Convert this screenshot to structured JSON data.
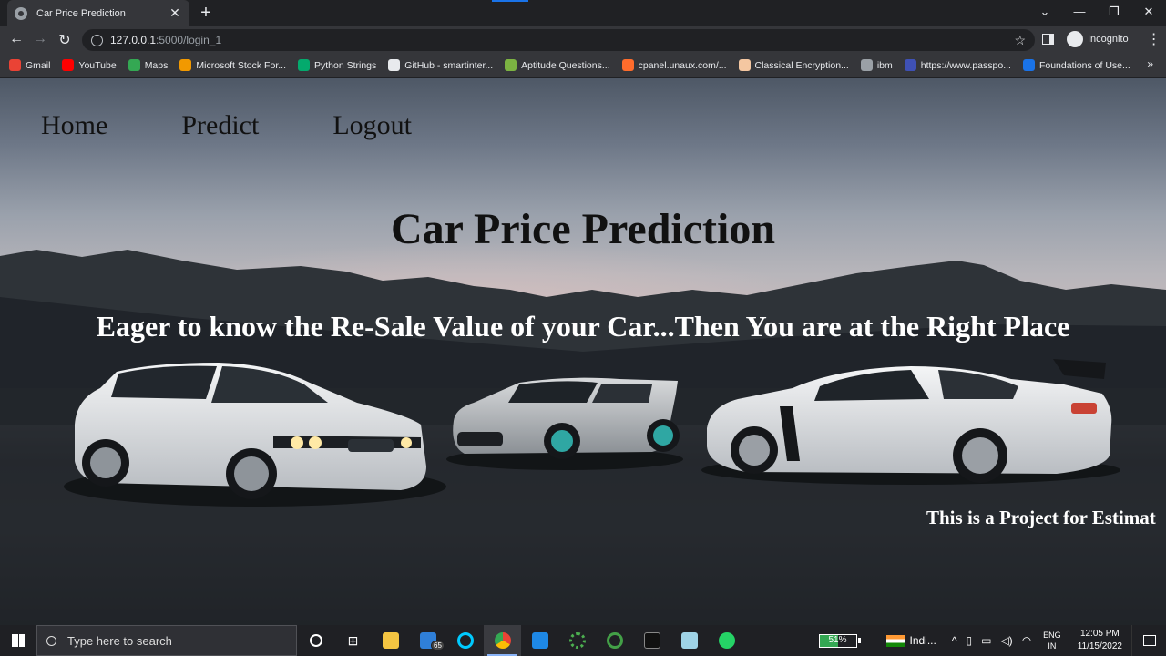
{
  "browser": {
    "tab_title": "Car Price Prediction",
    "tab_close": "✕",
    "new_tab": "+",
    "window_controls": [
      "⌄",
      "—",
      "❐",
      "✕"
    ],
    "url_host": "127.0.0.1",
    "url_path": ":5000/login_1",
    "incognito_label": "Incognito",
    "bookmarks": [
      {
        "label": "Gmail",
        "color": "#ea4335"
      },
      {
        "label": "YouTube",
        "color": "#ff0000"
      },
      {
        "label": "Maps",
        "color": "#34a853"
      },
      {
        "label": "Microsoft Stock For...",
        "color": "#f29900"
      },
      {
        "label": "Python Strings",
        "color": "#04aa6d"
      },
      {
        "label": "GitHub - smartinter...",
        "color": "#e8eaed"
      },
      {
        "label": "Aptitude Questions...",
        "color": "#7cb342"
      },
      {
        "label": "cpanel.unaux.com/...",
        "color": "#ff6c2c"
      },
      {
        "label": "Classical Encryption...",
        "color": "#f4c7a1"
      },
      {
        "label": "ibm",
        "color": "#9aa0a6"
      },
      {
        "label": "https://www.passpo...",
        "color": "#3f51b5"
      },
      {
        "label": "Foundations of Use...",
        "color": "#1a73e8"
      }
    ],
    "bookmarks_more": "»"
  },
  "page": {
    "nav": [
      "Home",
      "Predict",
      "Logout"
    ],
    "title": "Car Price Prediction",
    "subtitle": "Eager to know the Re-Sale Value of your Car...Then You are at the Right Place",
    "marquee": "This is a Project for Estimat"
  },
  "taskbar": {
    "search_placeholder": "Type here to search",
    "mail_badge": "65",
    "battery_percent": "51%",
    "battery_level": 0.51,
    "weather": "Indi...",
    "lang_line1": "ENG",
    "lang_line2": "IN",
    "time": "12:05 PM",
    "date": "11/15/2022"
  }
}
